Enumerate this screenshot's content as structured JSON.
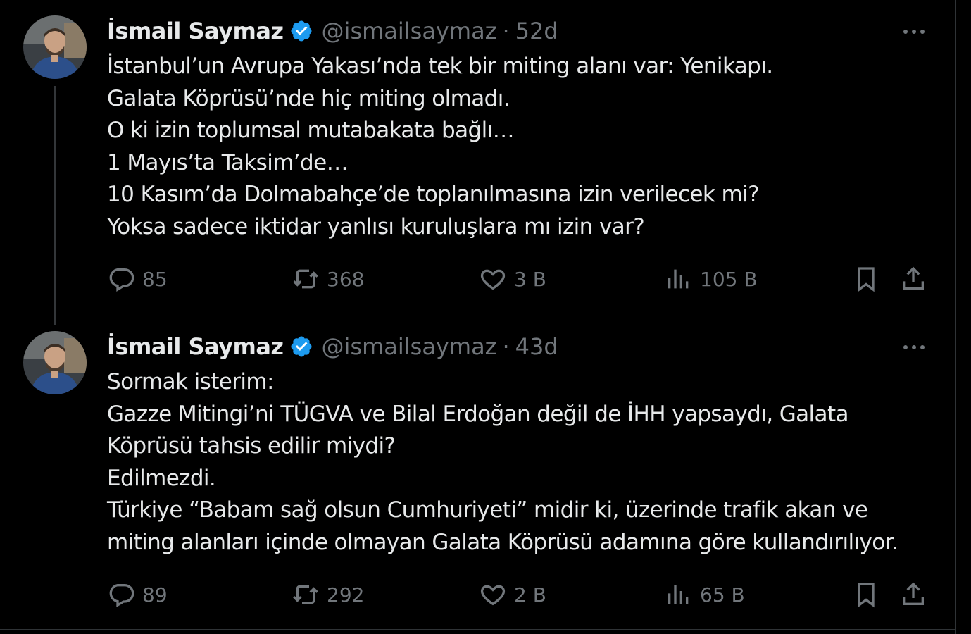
{
  "tweets": [
    {
      "author": {
        "name": "İsmail Saymaz",
        "handle": "@ismailsaymaz",
        "separator": "·",
        "time": "52d"
      },
      "lines": [
        "İstanbul’un Avrupa Yakası’nda tek bir miting alanı var: Yenikapı.",
        "Galata Köprüsü’nde hiç miting olmadı.",
        "O ki izin toplumsal mutabakata bağlı…",
        "1 Mayıs’ta Taksim’de…",
        "10 Kasım’da Dolmabahçe’de toplanılmasına izin verilecek mi?",
        "Yoksa sadece iktidar yanlısı kuruluşlara mı izin var?"
      ],
      "stats": {
        "replies": "85",
        "reposts": "368",
        "likes": "3 B",
        "views": "105 B"
      }
    },
    {
      "author": {
        "name": "İsmail Saymaz",
        "handle": "@ismailsaymaz",
        "separator": "·",
        "time": "43d"
      },
      "lines": [
        "Sormak isterim:",
        "Gazze Mitingi’ni TÜGVA ve Bilal Erdoğan değil de İHH yapsaydı, Galata",
        "Köprüsü tahsis edilir miydi?",
        "Edilmezdi.",
        "Türkiye “Babam sağ olsun Cumhuriyeti” midir ki, üzerinde trafik akan ve",
        "miting alanları içinde olmayan Galata Köprüsü adamına göre kullandırılıyor."
      ],
      "stats": {
        "replies": "89",
        "reposts": "292",
        "likes": "2 B",
        "views": "65 B"
      }
    }
  ],
  "colors": {
    "background": "#000000",
    "text": "#e7e9ea",
    "muted": "#71767b",
    "verified": "#1d9bf0",
    "border": "#2f3336"
  },
  "icons": [
    "verified-badge-icon",
    "more-options-icon",
    "reply-icon",
    "repost-icon",
    "like-icon",
    "views-icon",
    "bookmark-icon",
    "share-icon"
  ]
}
